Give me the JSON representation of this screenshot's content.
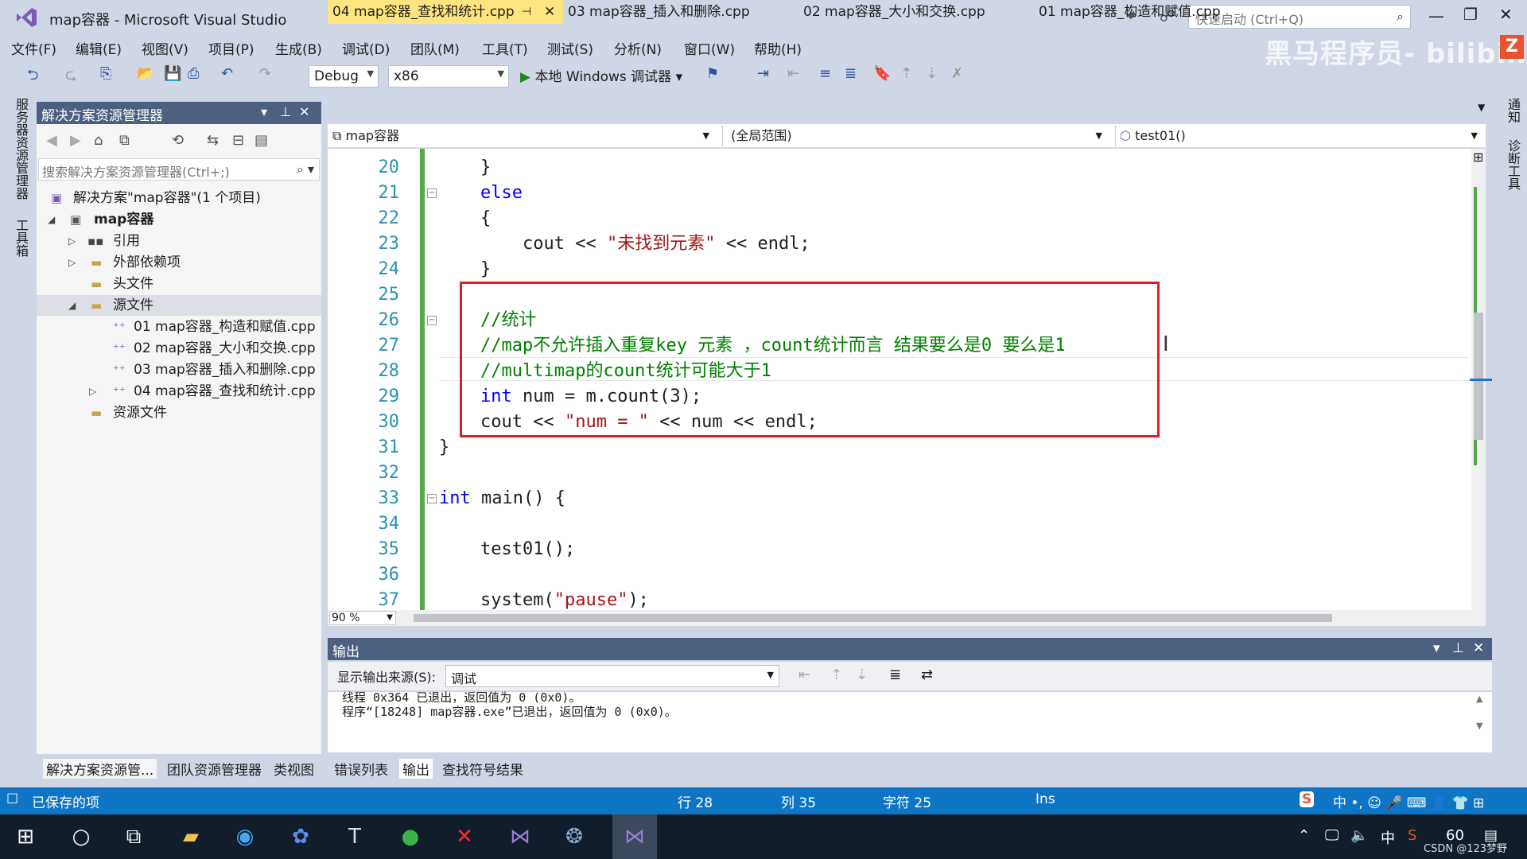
{
  "window": {
    "title": "map容器 - Microsoft Visual Studio"
  },
  "titlebar": {
    "quick_launch_placeholder": "快速启动 (Ctrl+Q)",
    "watermark": "黑马程序员- bilibili"
  },
  "menu": [
    "文件(F)",
    "编辑(E)",
    "视图(V)",
    "项目(P)",
    "生成(B)",
    "调试(D)",
    "团队(M)",
    "工具(T)",
    "测试(S)",
    "分析(N)",
    "窗口(W)",
    "帮助(H)"
  ],
  "toolbar": {
    "config": "Debug",
    "platform": "x86",
    "run_label": "本地 Windows 调试器"
  },
  "left_edge": {
    "server_explorer": "服务器资源管理器",
    "toolbox": "工具箱"
  },
  "right_edge": {
    "notifications": "通知",
    "diagnostics": "诊断工具"
  },
  "solution_explorer": {
    "title": "解决方案资源管理器",
    "search_placeholder": "搜索解决方案资源管理器(Ctrl+;)",
    "solution": "解决方案\"map容器\"(1 个项目)",
    "project": "map容器",
    "references": "引用",
    "external": "外部依赖项",
    "headers": "头文件",
    "sources": "源文件",
    "files": [
      "01 map容器_构造和赋值.cpp",
      "02 map容器_大小和交换.cpp",
      "03 map容器_插入和删除.cpp",
      "04 map容器_查找和统计.cpp"
    ],
    "resources": "资源文件",
    "bottom_tabs": [
      "解决方案资源管...",
      "团队资源管理器",
      "类视图"
    ]
  },
  "editor": {
    "tabs": [
      "04 map容器_查找和统计.cpp",
      "03 map容器_插入和删除.cpp",
      "02 map容器_大小和交换.cpp",
      "01 map容器_构造和赋值.cpp"
    ],
    "nav_project": "map容器",
    "nav_scope": "(全局范围)",
    "nav_member": "test01()",
    "zoom": "90 %",
    "line_numbers": [
      "20",
      "21",
      "22",
      "23",
      "24",
      "25",
      "26",
      "27",
      "28",
      "29",
      "30",
      "31",
      "32",
      "33",
      "34",
      "35",
      "36",
      "37"
    ]
  },
  "output": {
    "title": "输出",
    "source_label": "显示输出来源(S):",
    "source_value": "调试",
    "lines": [
      "线程 0x364 已退出，返回值为 0 (0x0)。",
      "程序“[18248] map容器.exe”已退出，返回值为 0 (0x0)。"
    ],
    "tabs": [
      "错误列表",
      "输出",
      "查找符号结果"
    ]
  },
  "status": {
    "left": "已保存的项",
    "row": "行 28",
    "col": "列 35",
    "char": "字符 25",
    "mode": "Ins"
  },
  "taskbar": {
    "ime": "中",
    "temp": "60",
    "credit": "CSDN @123梦野"
  }
}
